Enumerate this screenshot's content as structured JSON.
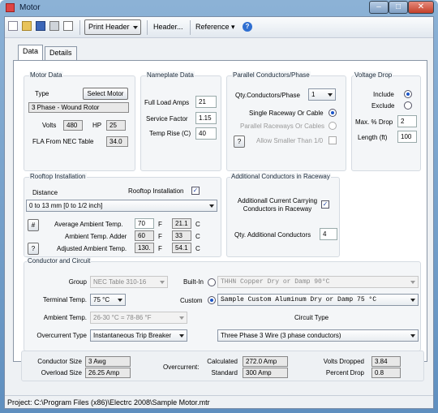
{
  "window": {
    "title": "Motor",
    "min": "–",
    "max": "□",
    "close": "✕"
  },
  "toolbar": {
    "print_header": "Print Header",
    "header": "Header...",
    "reference": "Reference",
    "help": "?"
  },
  "tabs": {
    "data": "Data",
    "details": "Details"
  },
  "motor_data": {
    "title": "Motor Data",
    "type_label": "Type",
    "select_btn": "Select Motor",
    "type_value": "3 Phase - Wound Rotor",
    "volts_label": "Volts",
    "volts": "480",
    "hp_label": "HP",
    "hp": "25",
    "fla_label": "FLA From NEC Table",
    "fla": "34.0"
  },
  "nameplate": {
    "title": "Nameplate Data",
    "fla_label": "Full Load Amps",
    "fla": "21",
    "sf_label": "Service Factor",
    "sf": "1.15",
    "tr_label": "Temp Rise (C)",
    "tr": "40"
  },
  "parallel": {
    "title": "Parallel Conductors/Phase",
    "qty_label": "Qty.Conductors/Phase",
    "qty": "1",
    "single": "Single Raceway Or Cable",
    "parallel": "Parallel Raceways Or Cables",
    "allow": "Allow Smaller Than 1/0",
    "help": "?"
  },
  "voltage_drop": {
    "title": "Voltage Drop",
    "include": "Include",
    "exclude": "Exclude",
    "max_label": "Max. % Drop",
    "max": "2",
    "len_label": "Length  (ft)",
    "len": "100"
  },
  "rooftop": {
    "title": "Rooftop Installation",
    "distance_label": "Distance",
    "rooftop_label": "Rooftop Installation",
    "checked": "✓",
    "distance": "0 to 13 mm [0 to 1/2 inch]",
    "hash": "#",
    "help": "?",
    "avg_label": "Average Ambient Temp.",
    "avg_f": "70",
    "avg_c": "21.1",
    "adder_label": "Ambient Temp. Adder",
    "adder_f": "60",
    "adder_c": "33",
    "adj_label": "Adjusted Ambient Temp.",
    "adj_f": "130.",
    "adj_c": "54.1",
    "f": "F",
    "c": "C"
  },
  "additional": {
    "title": "Additional Conductors in Raceway",
    "all_label": "Additionall Current Carrying Conductors in Raceway",
    "checked": "✓",
    "qty_label": "Qty. Additional Conductors",
    "qty": "4"
  },
  "circuit": {
    "title": "Conductor and Circuit",
    "group_label": "Group",
    "group": "NEC Table 310-16",
    "terminal_label": "Terminal Temp.",
    "terminal": "75 °C",
    "ambient_label": "Ambient Temp.",
    "ambient": "26-30 °C = 78-86 °F",
    "oc_label": "Overcurrent Type",
    "oc": "Instantaneous Trip Breaker",
    "builtin_label": "Built-In",
    "builtin": "THHN   Copper      Dry or Damp   90°C",
    "custom_label": "Custom",
    "custom": "Sample Custom  Aluminum  Dry or Damp 75 °C",
    "ct_label": "Circuit Type",
    "ct": "Three Phase 3 Wire (3 phase conductors)"
  },
  "results": {
    "cs_label": "Conductor Size",
    "cs": "3 Awg",
    "os_label": "Overload Size",
    "os": "26.25 Amp",
    "oc_label": "Overcurrent:",
    "calc_label": "Calculated",
    "calc": "272.0 Amp",
    "std_label": "Standard",
    "std": "300 Amp",
    "vd_label": "Volts Dropped",
    "vd": "3.84",
    "pd_label": "Percent Drop",
    "pd": "0.8"
  },
  "status": {
    "project": "Project: C:\\Program Files (x86)\\Electrc 2008\\Sample Motor.mtr"
  }
}
